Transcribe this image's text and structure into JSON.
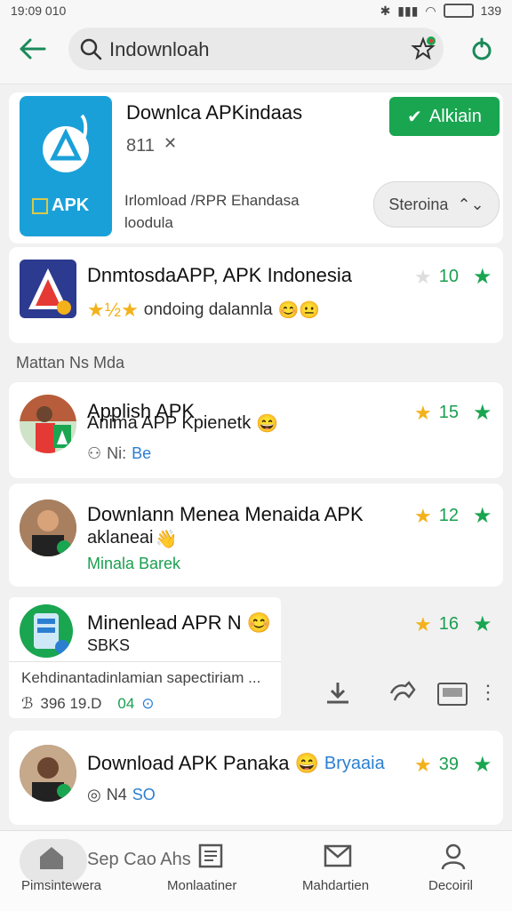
{
  "status": {
    "time": "19:09 010",
    "battery": "139"
  },
  "search": {
    "query": "Indownloah"
  },
  "app": {
    "title": "Downlca APKindaas",
    "meta": "811",
    "install_label": "Alkiain",
    "icon_text": "APK",
    "desc_line1": "Irlomload /RPR Ehandasa",
    "desc_line2": "loodula",
    "secondary_button": "Steroina"
  },
  "featured": {
    "title": "DnmtosdaAPP, APK Indonesia",
    "rating": "10",
    "subtitle": "ondoing dalannla"
  },
  "section_label": "Mattan Ns Mda",
  "items": [
    {
      "title_top": "Applish APK",
      "title_bottom": "Anima APP Kpienetk",
      "rating": "15",
      "meta_prefix": "Ni:",
      "meta_link": "Be"
    },
    {
      "title1": "Downlann Menea Menaida APK",
      "title2": "aklaneai",
      "rating": "12",
      "meta_link": "Minala Barek"
    },
    {
      "title": "Minenlead APR N",
      "sub": "SBKS",
      "rating": "16",
      "desc": "Kehdinantadinlamian sapectiriam ...",
      "meta_num": "396 19.D",
      "meta_green": "04"
    },
    {
      "title": "Download APK Panaka",
      "title_link": "Bryaaia",
      "rating": "39",
      "meta": "N4",
      "meta_link": "SO"
    }
  ],
  "nav": [
    {
      "label": "Pimsintewera",
      "overlay": "Sep Cao Ahs"
    },
    {
      "label": "Monlaatiner"
    },
    {
      "label": "Mahdartien"
    },
    {
      "label": "Decoiril"
    }
  ],
  "colors": {
    "accent": "#1aa551",
    "link": "#2b7fd0",
    "star": "#f3b11b",
    "icon_bg": "#1aa0d8"
  }
}
